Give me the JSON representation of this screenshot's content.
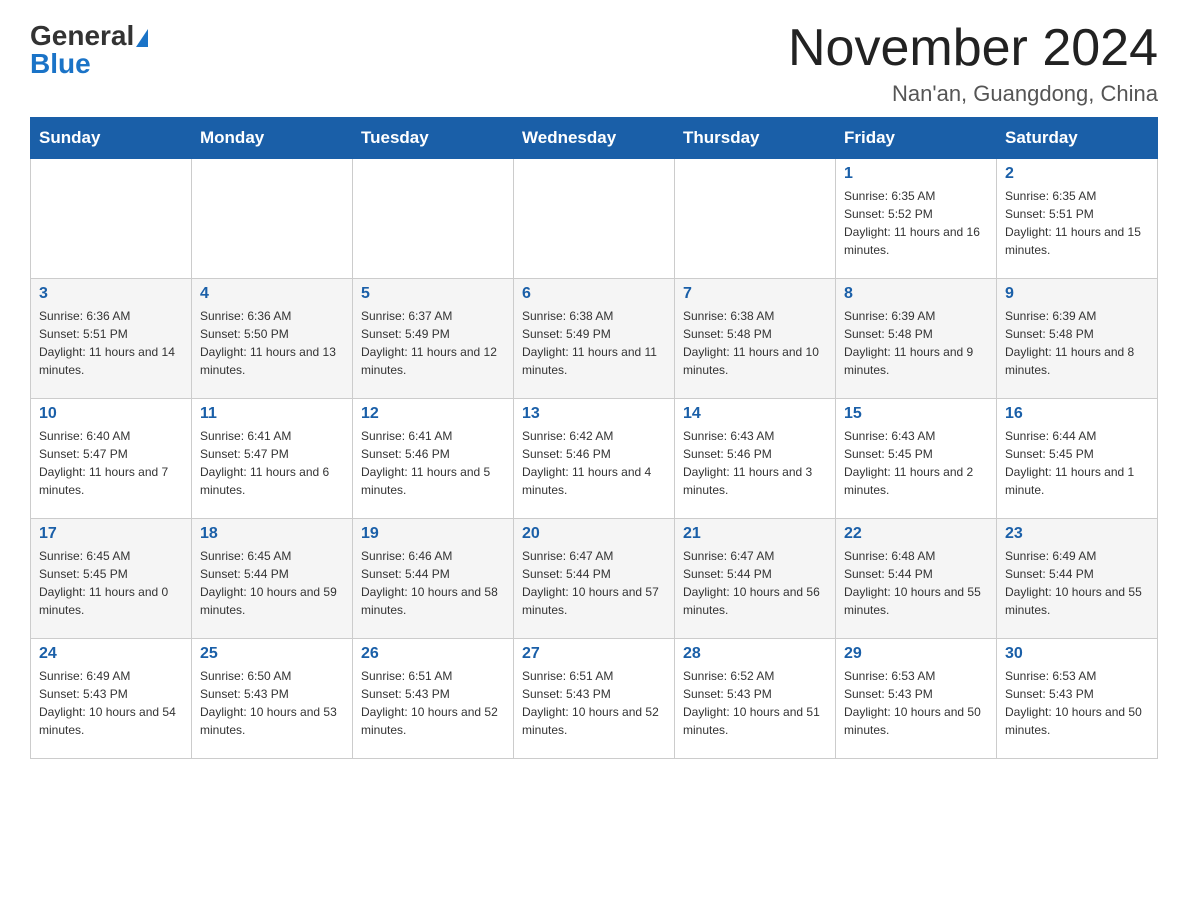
{
  "header": {
    "logo_part1": "General",
    "logo_part2": "Blue",
    "month_title": "November 2024",
    "location": "Nan'an, Guangdong, China"
  },
  "days_of_week": [
    "Sunday",
    "Monday",
    "Tuesday",
    "Wednesday",
    "Thursday",
    "Friday",
    "Saturday"
  ],
  "weeks": [
    [
      {
        "day": "",
        "info": ""
      },
      {
        "day": "",
        "info": ""
      },
      {
        "day": "",
        "info": ""
      },
      {
        "day": "",
        "info": ""
      },
      {
        "day": "",
        "info": ""
      },
      {
        "day": "1",
        "info": "Sunrise: 6:35 AM\nSunset: 5:52 PM\nDaylight: 11 hours and 16 minutes."
      },
      {
        "day": "2",
        "info": "Sunrise: 6:35 AM\nSunset: 5:51 PM\nDaylight: 11 hours and 15 minutes."
      }
    ],
    [
      {
        "day": "3",
        "info": "Sunrise: 6:36 AM\nSunset: 5:51 PM\nDaylight: 11 hours and 14 minutes."
      },
      {
        "day": "4",
        "info": "Sunrise: 6:36 AM\nSunset: 5:50 PM\nDaylight: 11 hours and 13 minutes."
      },
      {
        "day": "5",
        "info": "Sunrise: 6:37 AM\nSunset: 5:49 PM\nDaylight: 11 hours and 12 minutes."
      },
      {
        "day": "6",
        "info": "Sunrise: 6:38 AM\nSunset: 5:49 PM\nDaylight: 11 hours and 11 minutes."
      },
      {
        "day": "7",
        "info": "Sunrise: 6:38 AM\nSunset: 5:48 PM\nDaylight: 11 hours and 10 minutes."
      },
      {
        "day": "8",
        "info": "Sunrise: 6:39 AM\nSunset: 5:48 PM\nDaylight: 11 hours and 9 minutes."
      },
      {
        "day": "9",
        "info": "Sunrise: 6:39 AM\nSunset: 5:48 PM\nDaylight: 11 hours and 8 minutes."
      }
    ],
    [
      {
        "day": "10",
        "info": "Sunrise: 6:40 AM\nSunset: 5:47 PM\nDaylight: 11 hours and 7 minutes."
      },
      {
        "day": "11",
        "info": "Sunrise: 6:41 AM\nSunset: 5:47 PM\nDaylight: 11 hours and 6 minutes."
      },
      {
        "day": "12",
        "info": "Sunrise: 6:41 AM\nSunset: 5:46 PM\nDaylight: 11 hours and 5 minutes."
      },
      {
        "day": "13",
        "info": "Sunrise: 6:42 AM\nSunset: 5:46 PM\nDaylight: 11 hours and 4 minutes."
      },
      {
        "day": "14",
        "info": "Sunrise: 6:43 AM\nSunset: 5:46 PM\nDaylight: 11 hours and 3 minutes."
      },
      {
        "day": "15",
        "info": "Sunrise: 6:43 AM\nSunset: 5:45 PM\nDaylight: 11 hours and 2 minutes."
      },
      {
        "day": "16",
        "info": "Sunrise: 6:44 AM\nSunset: 5:45 PM\nDaylight: 11 hours and 1 minute."
      }
    ],
    [
      {
        "day": "17",
        "info": "Sunrise: 6:45 AM\nSunset: 5:45 PM\nDaylight: 11 hours and 0 minutes."
      },
      {
        "day": "18",
        "info": "Sunrise: 6:45 AM\nSunset: 5:44 PM\nDaylight: 10 hours and 59 minutes."
      },
      {
        "day": "19",
        "info": "Sunrise: 6:46 AM\nSunset: 5:44 PM\nDaylight: 10 hours and 58 minutes."
      },
      {
        "day": "20",
        "info": "Sunrise: 6:47 AM\nSunset: 5:44 PM\nDaylight: 10 hours and 57 minutes."
      },
      {
        "day": "21",
        "info": "Sunrise: 6:47 AM\nSunset: 5:44 PM\nDaylight: 10 hours and 56 minutes."
      },
      {
        "day": "22",
        "info": "Sunrise: 6:48 AM\nSunset: 5:44 PM\nDaylight: 10 hours and 55 minutes."
      },
      {
        "day": "23",
        "info": "Sunrise: 6:49 AM\nSunset: 5:44 PM\nDaylight: 10 hours and 55 minutes."
      }
    ],
    [
      {
        "day": "24",
        "info": "Sunrise: 6:49 AM\nSunset: 5:43 PM\nDaylight: 10 hours and 54 minutes."
      },
      {
        "day": "25",
        "info": "Sunrise: 6:50 AM\nSunset: 5:43 PM\nDaylight: 10 hours and 53 minutes."
      },
      {
        "day": "26",
        "info": "Sunrise: 6:51 AM\nSunset: 5:43 PM\nDaylight: 10 hours and 52 minutes."
      },
      {
        "day": "27",
        "info": "Sunrise: 6:51 AM\nSunset: 5:43 PM\nDaylight: 10 hours and 52 minutes."
      },
      {
        "day": "28",
        "info": "Sunrise: 6:52 AM\nSunset: 5:43 PM\nDaylight: 10 hours and 51 minutes."
      },
      {
        "day": "29",
        "info": "Sunrise: 6:53 AM\nSunset: 5:43 PM\nDaylight: 10 hours and 50 minutes."
      },
      {
        "day": "30",
        "info": "Sunrise: 6:53 AM\nSunset: 5:43 PM\nDaylight: 10 hours and 50 minutes."
      }
    ]
  ]
}
